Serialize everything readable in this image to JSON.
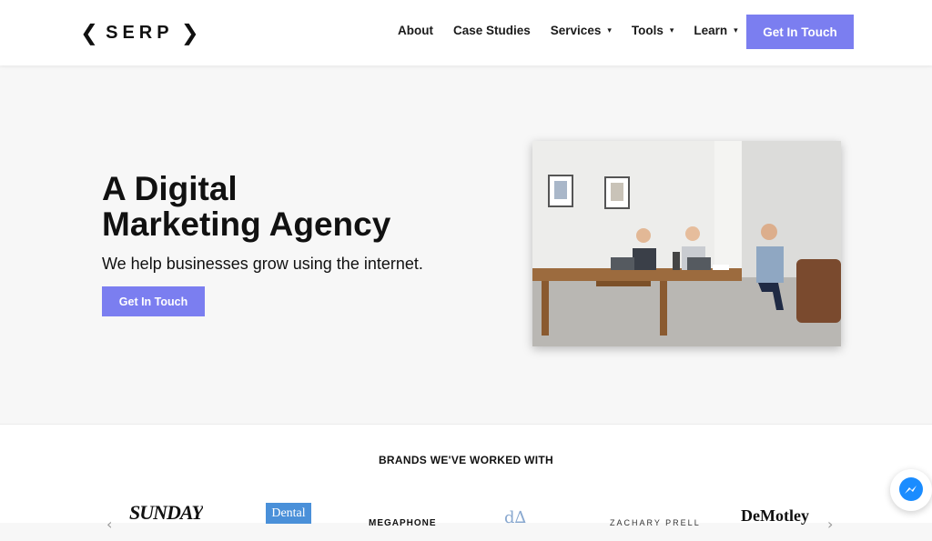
{
  "logo": {
    "left": "❮",
    "text": "SERP",
    "right": "❯"
  },
  "nav": {
    "items": [
      {
        "label": "About"
      },
      {
        "label": "Case Studies"
      },
      {
        "label": "Services"
      },
      {
        "label": "Tools"
      },
      {
        "label": "Learn"
      }
    ],
    "chevron": "⌄",
    "cta": "Get In Touch"
  },
  "hero": {
    "title_line1": "A Digital",
    "title_line2": "Marketing Agency",
    "subtitle": "We help businesses grow using the internet.",
    "cta": "Get In Touch"
  },
  "brands": {
    "title": "BRANDS WE'VE WORKED WITH",
    "logos": [
      "SUNDAY",
      "Dental",
      "MEGAPHONE",
      "d∆",
      "ZACHARY PRELL",
      "DeMotley"
    ],
    "prev": "‹",
    "next": "›"
  },
  "colors": {
    "accent": "#7b7ef0",
    "messenger": "#1a8cff"
  }
}
